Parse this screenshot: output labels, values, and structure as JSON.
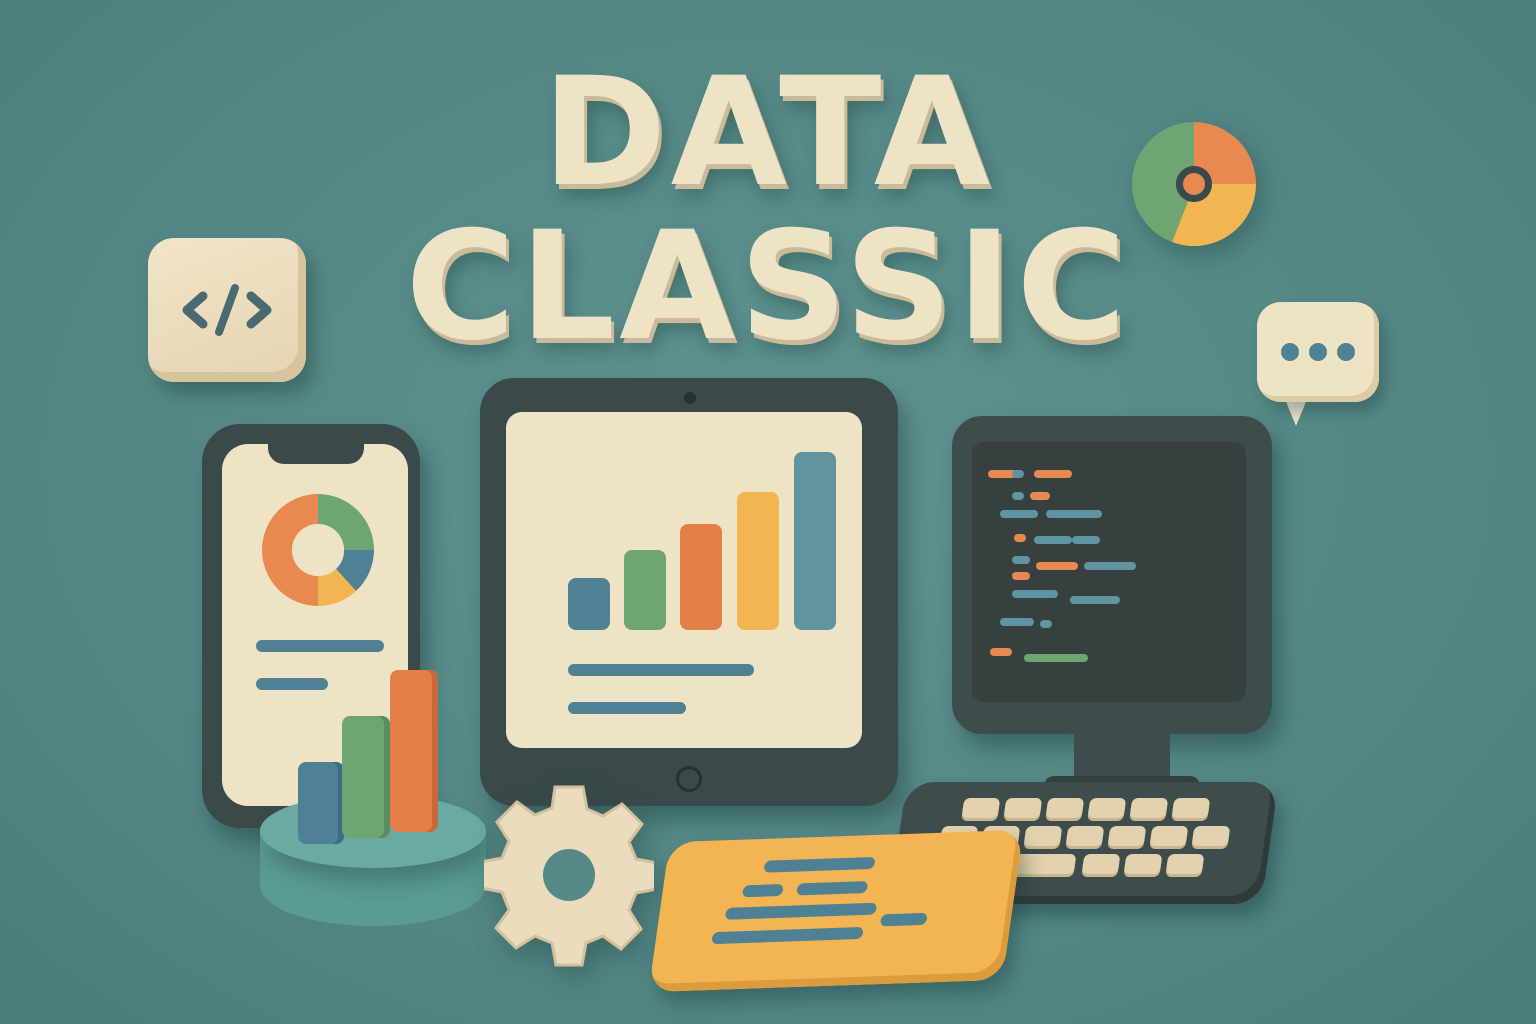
{
  "title": {
    "line1": "DATA",
    "line2": "CLASSIC"
  },
  "icons": {
    "code": "code-brackets-icon",
    "chat": "speech-bubble-icon",
    "donut": "donut-chart-icon",
    "gear": "gear-icon"
  },
  "colors": {
    "background": "#568a88",
    "cream": "#efe3c6",
    "blue": "#4f8194",
    "green": "#6fa473",
    "orange": "#e57f4a",
    "yellow": "#f2b552",
    "dark": "#3a4a4a"
  }
}
